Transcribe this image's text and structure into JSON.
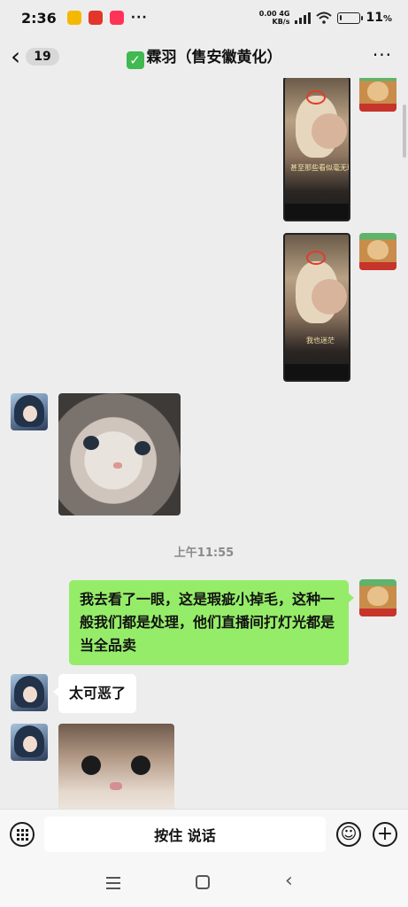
{
  "status_bar": {
    "time": "2:36",
    "net_speed_value": "0.00",
    "net_speed_unit": "KB/s",
    "network_type": "4G",
    "battery_pct": "11",
    "battery_level": 0.11,
    "app_chips": [
      {
        "name": "note-app-icon",
        "color": "#f5b800"
      },
      {
        "name": "shopping-app-icon",
        "color": "#e2362a"
      },
      {
        "name": "video-app-icon",
        "color": "#ff3355"
      }
    ],
    "more_dots": "···"
  },
  "header": {
    "back_glyph": "‹",
    "unread_count": "19",
    "check_glyph": "✓",
    "title": "霖羽（售安徽黄化）",
    "more_glyph": "···"
  },
  "messages": {
    "image1_caption": "甚至那些看似毫无瑕",
    "image2_caption": "我也迷茫",
    "timestamp": "上午11:55",
    "my_text": "我去看了一眼，这是瑕疵小掉毛，这种一般我们都是处理，他们直播间打灯光都是当全品卖",
    "other_text": "太可恶了"
  },
  "input_bar": {
    "hold_to_talk": "按住 说话",
    "emoji_glyph": "☺",
    "plus_glyph": "+"
  },
  "nav_bar": {
    "back_glyph": "‹"
  },
  "colors": {
    "background": "#ededed",
    "my_bubble": "#95ec69",
    "other_bubble": "#ffffff"
  }
}
